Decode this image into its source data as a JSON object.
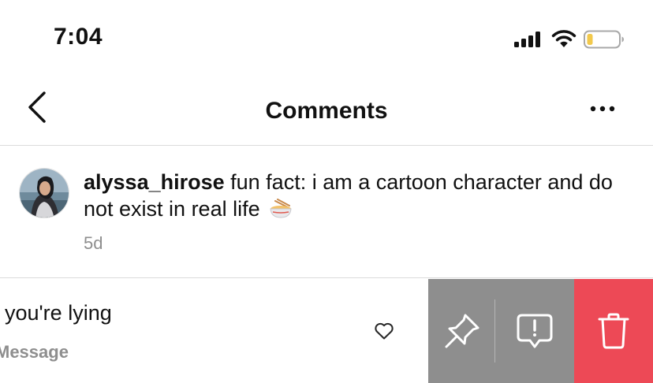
{
  "status_bar": {
    "time": "7:04",
    "signal_icon": "cellular-signal-icon",
    "wifi_icon": "wifi-icon",
    "battery_icon": "battery-low-icon",
    "battery_level": 0.15,
    "battery_color": "#f2c94c"
  },
  "header": {
    "title": "Comments",
    "back_icon": "chevron-left-icon",
    "more_icon": "more-horizontal-icon"
  },
  "caption": {
    "username": "alyssa_hirose",
    "text": "fun fact: i am a cartoon character and do not exist in real life",
    "emoji_icon": "ramen-bowl-emoji",
    "time": "5d"
  },
  "reply": {
    "text": "you're lying",
    "meta": "Message",
    "like_icon": "heart-outline-icon"
  },
  "swipe_actions": {
    "pin_icon": "pin-icon",
    "report_icon": "report-speech-bubble-icon",
    "delete_icon": "trash-icon",
    "neutral_color": "#8e8e8e",
    "delete_color": "#ed4956"
  }
}
